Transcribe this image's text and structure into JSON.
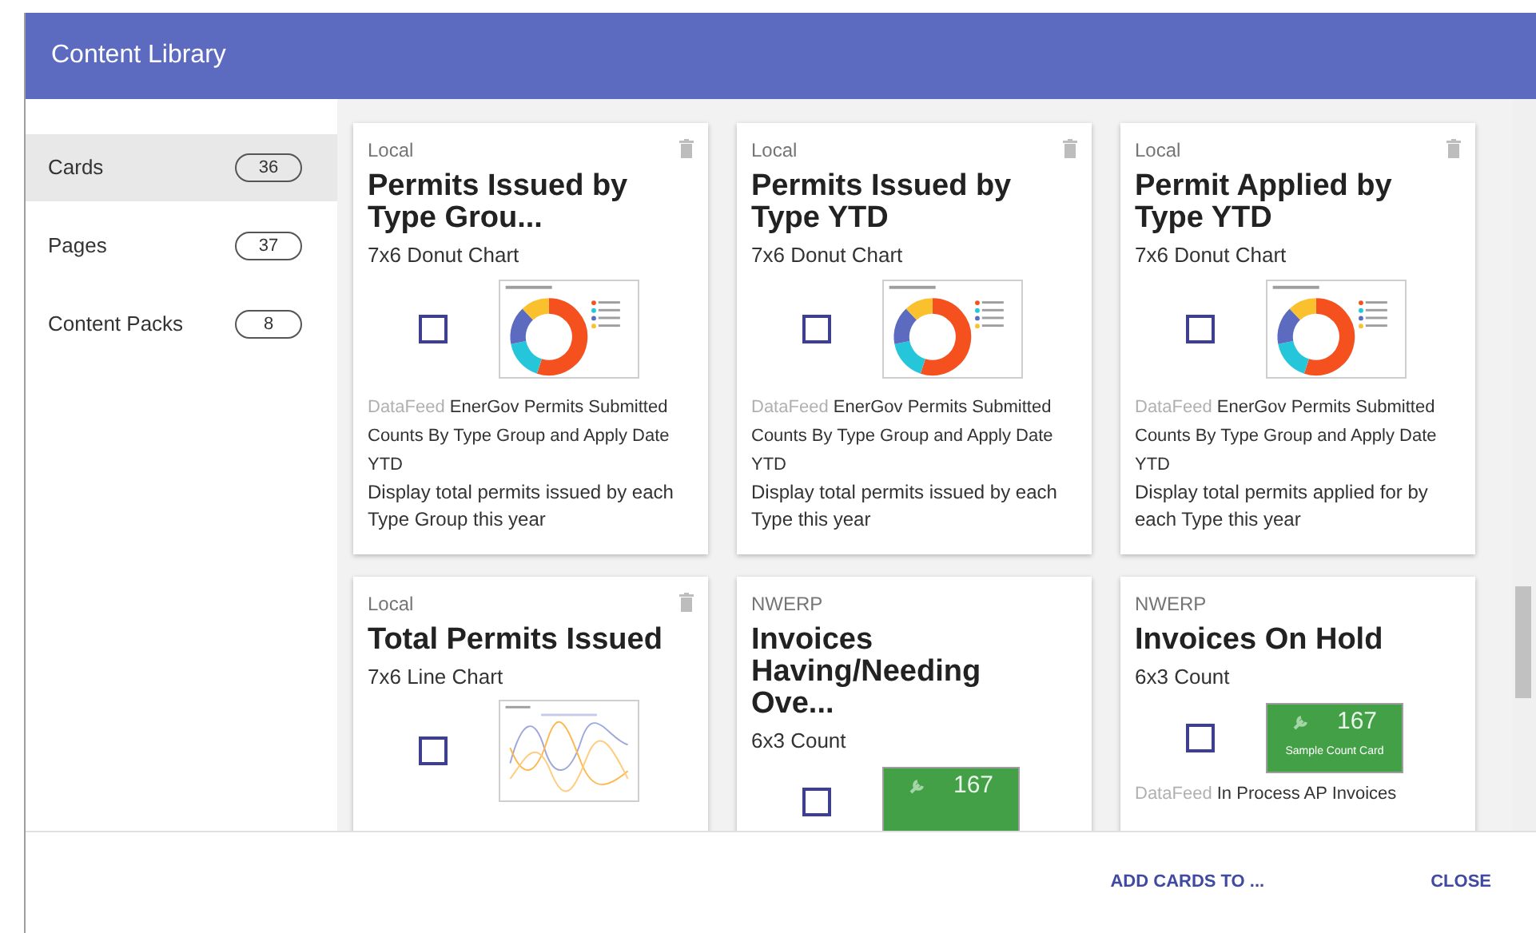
{
  "dialog": {
    "title": "Content Library"
  },
  "sidebar": {
    "items": [
      {
        "label": "Cards",
        "count": "36",
        "selected": true
      },
      {
        "label": "Pages",
        "count": "37",
        "selected": false
      },
      {
        "label": "Content Packs",
        "count": "8",
        "selected": false
      }
    ]
  },
  "cards": [
    {
      "source": "Local",
      "deletable": true,
      "title": "Permits Issued by Type Grou...",
      "subtitle": "7x6 Donut Chart",
      "checked": false,
      "preview": {
        "kind": "donut"
      },
      "datafeed_label": "DataFeed",
      "datafeed": "EnerGov Permits Submitted Counts By Type Group and Apply Date YTD",
      "description": "Display total permits issued by each Type Group this year"
    },
    {
      "source": "Local",
      "deletable": true,
      "title": "Permits Issued by Type YTD",
      "subtitle": "7x6 Donut Chart",
      "checked": false,
      "preview": {
        "kind": "donut"
      },
      "datafeed_label": "DataFeed",
      "datafeed": "EnerGov Permits Submitted Counts By Type Group and Apply Date YTD",
      "description": "Display total permits issued by each Type this year"
    },
    {
      "source": "Local",
      "deletable": true,
      "title": "Permit Applied by Type YTD",
      "subtitle": "7x6 Donut Chart",
      "checked": false,
      "preview": {
        "kind": "donut"
      },
      "datafeed_label": "DataFeed",
      "datafeed": "EnerGov Permits Submitted Counts By Type Group and Apply Date YTD",
      "description": "Display total permits applied for by each Type this year"
    },
    {
      "source": "Local",
      "deletable": true,
      "title": "Total Permits Issued",
      "subtitle": "7x6 Line Chart",
      "checked": false,
      "preview": {
        "kind": "line"
      }
    },
    {
      "source": "NWERP",
      "deletable": false,
      "title": "Invoices Having/Needing Ove...",
      "subtitle": "6x3 Count",
      "checked": false,
      "preview": {
        "kind": "count",
        "value": "167"
      }
    },
    {
      "source": "NWERP",
      "deletable": false,
      "title": "Invoices On Hold",
      "subtitle": "6x3 Count",
      "checked": false,
      "preview": {
        "kind": "count",
        "value": "167",
        "label": "Sample Count Card"
      },
      "datafeed_label": "DataFeed",
      "datafeed": "In Process AP Invoices"
    }
  ],
  "footer": {
    "buttons": [
      "ADD CARDS TO ...",
      "CLOSE"
    ]
  }
}
